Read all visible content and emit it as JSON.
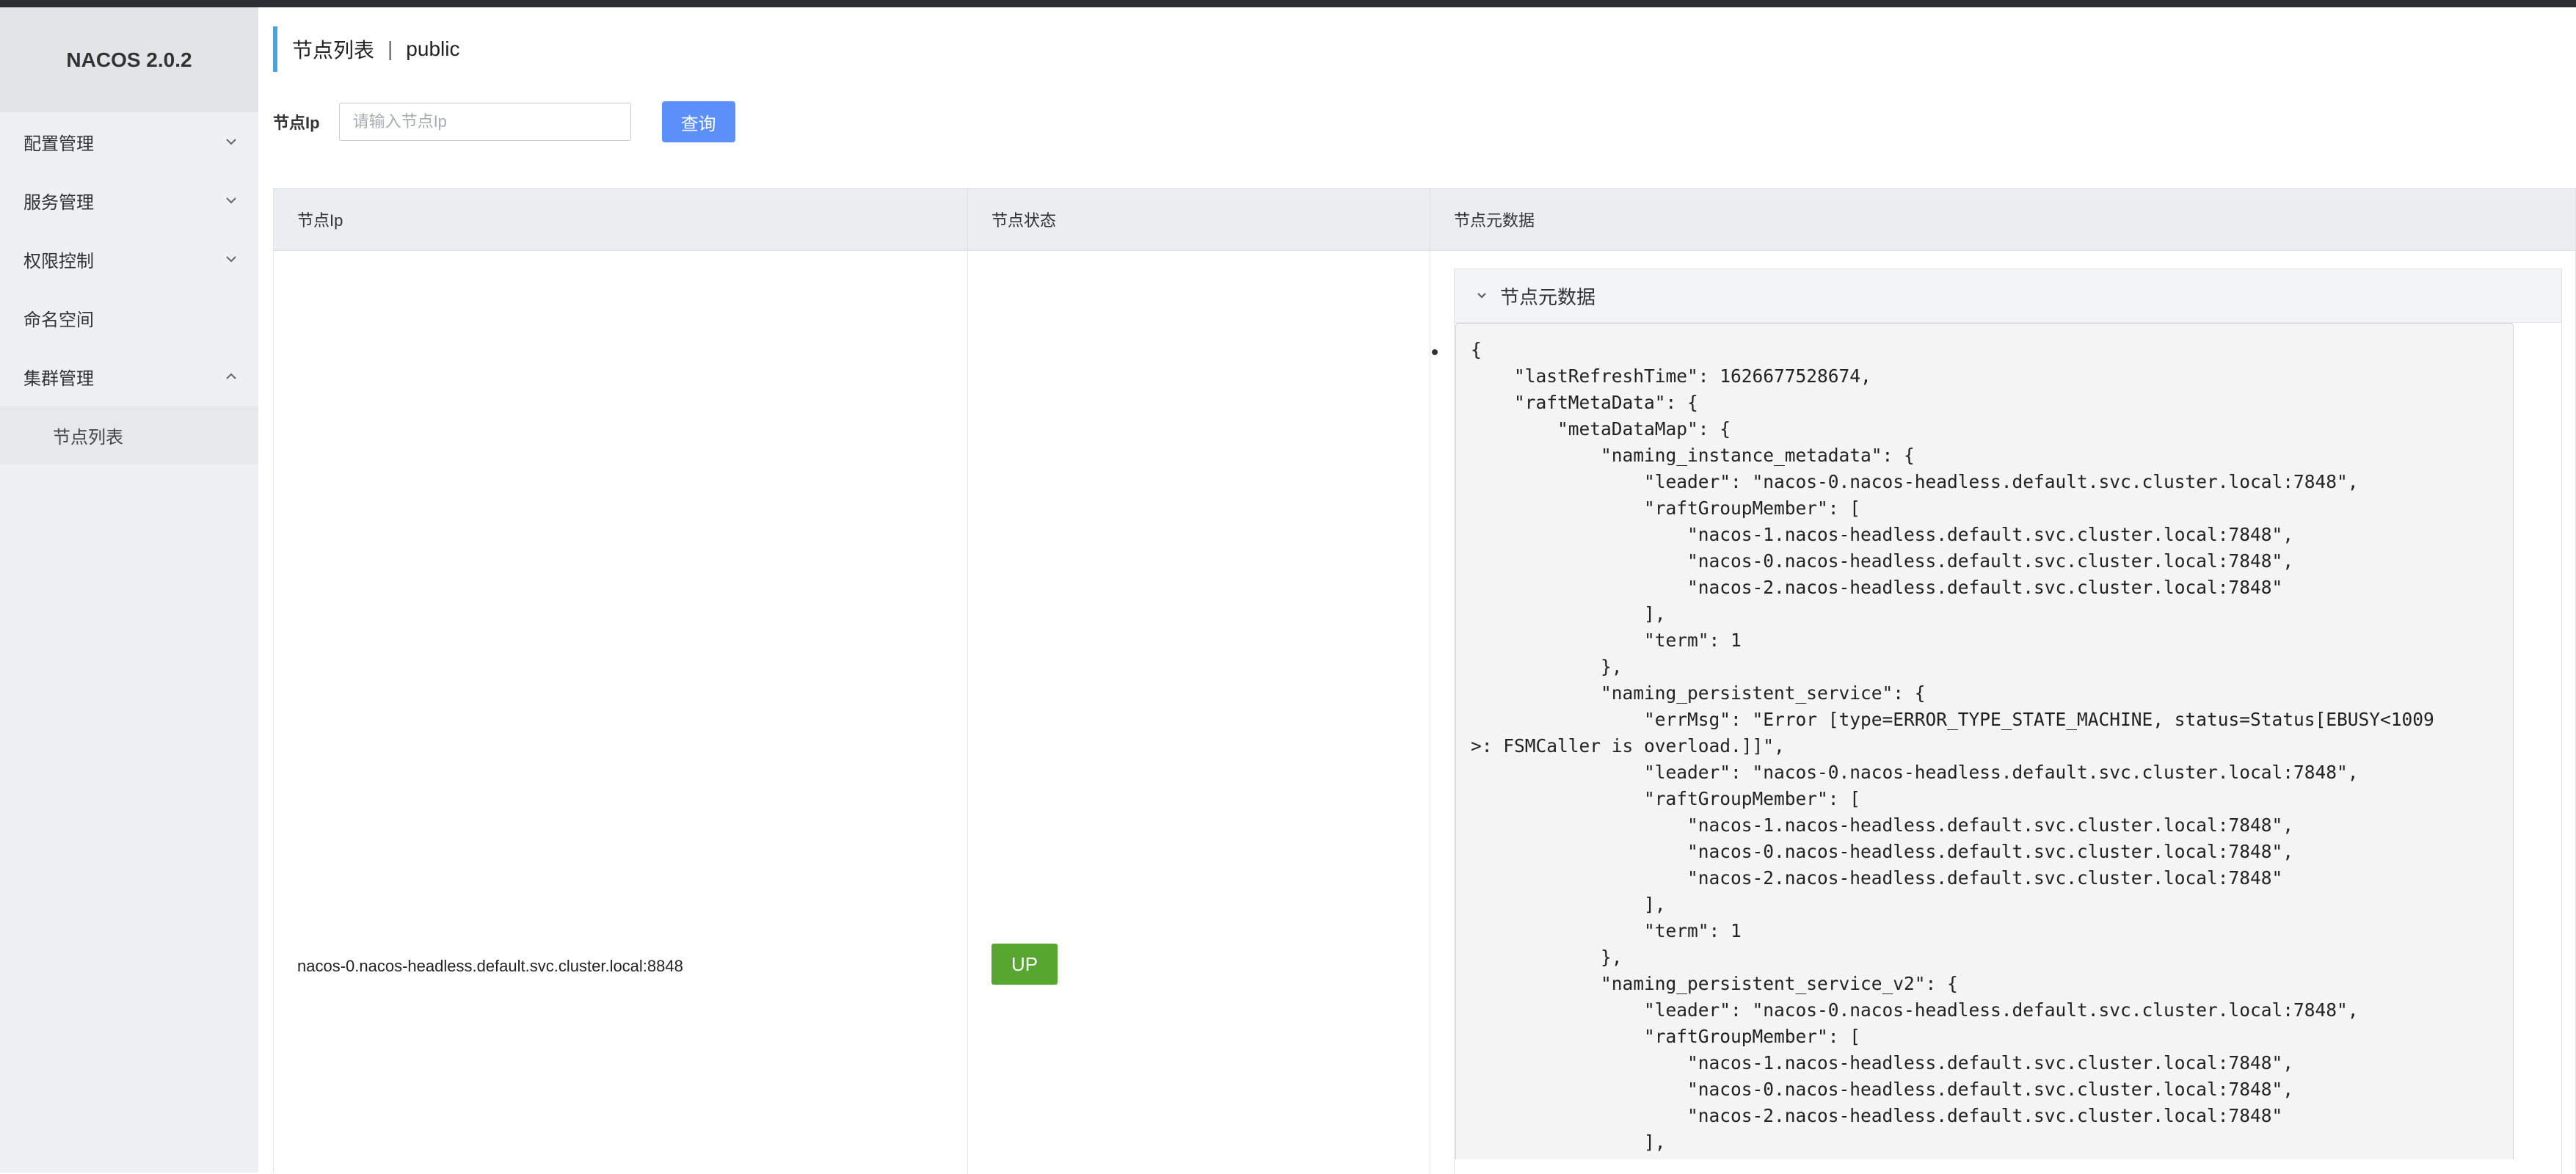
{
  "app": {
    "brand": "NACOS 2.0.2"
  },
  "sidebar": {
    "items": [
      {
        "label": "配置管理",
        "expanded": false
      },
      {
        "label": "服务管理",
        "expanded": false
      },
      {
        "label": "权限控制",
        "expanded": false
      },
      {
        "label": "命名空间"
      },
      {
        "label": "集群管理",
        "expanded": true
      }
    ],
    "sub_items": [
      {
        "label": "节点列表"
      }
    ]
  },
  "header": {
    "title": "节点列表",
    "separator": "|",
    "namespace": "public"
  },
  "filter": {
    "label": "节点Ip",
    "placeholder": "请输入节点Ip",
    "value": "",
    "query_label": "查询"
  },
  "table": {
    "columns": [
      "节点Ip",
      "节点状态",
      "节点元数据"
    ],
    "rows": [
      {
        "ip": "nacos-0.nacos-headless.default.svc.cluster.local:8848",
        "status": "UP",
        "metadata_title": "节点元数据",
        "metadata_json": "{\n    \"lastRefreshTime\": 1626677528674,\n    \"raftMetaData\": {\n        \"metaDataMap\": {\n            \"naming_instance_metadata\": {\n                \"leader\": \"nacos-0.nacos-headless.default.svc.cluster.local:7848\",\n                \"raftGroupMember\": [\n                    \"nacos-1.nacos-headless.default.svc.cluster.local:7848\",\n                    \"nacos-0.nacos-headless.default.svc.cluster.local:7848\",\n                    \"nacos-2.nacos-headless.default.svc.cluster.local:7848\"\n                ],\n                \"term\": 1\n            },\n            \"naming_persistent_service\": {\n                \"errMsg\": \"Error [type=ERROR_TYPE_STATE_MACHINE, status=Status[EBUSY<1009\n>: FSMCaller is overload.]]\",\n                \"leader\": \"nacos-0.nacos-headless.default.svc.cluster.local:7848\",\n                \"raftGroupMember\": [\n                    \"nacos-1.nacos-headless.default.svc.cluster.local:7848\",\n                    \"nacos-0.nacos-headless.default.svc.cluster.local:7848\",\n                    \"nacos-2.nacos-headless.default.svc.cluster.local:7848\"\n                ],\n                \"term\": 1\n            },\n            \"naming_persistent_service_v2\": {\n                \"leader\": \"nacos-0.nacos-headless.default.svc.cluster.local:7848\",\n                \"raftGroupMember\": [\n                    \"nacos-1.nacos-headless.default.svc.cluster.local:7848\",\n                    \"nacos-0.nacos-headless.default.svc.cluster.local:7848\",\n                    \"nacos-2.nacos-headless.default.svc.cluster.local:7848\"\n                ],"
      }
    ]
  },
  "colors": {
    "accent": "#5b8ff9",
    "status_up": "#56a62f",
    "title_bar": "#4aa3d9",
    "sidebar_bg": "#eef0f3"
  },
  "icons": {
    "collapsed": "chevron-down-icon",
    "expanded": "chevron-up-icon"
  }
}
